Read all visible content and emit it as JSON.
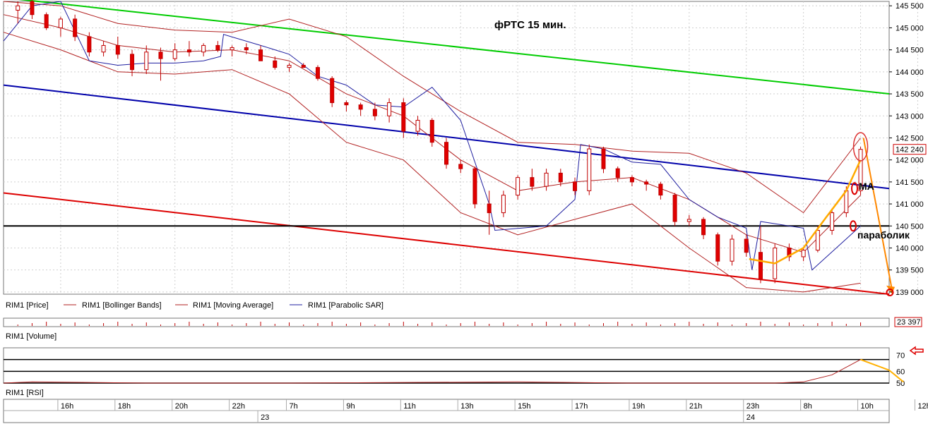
{
  "chart_data": {
    "type": "candlestick",
    "title": "фРТС   15 мин.",
    "price_axis": {
      "ylim": [
        138950,
        145600
      ],
      "ticks": [
        "145 500",
        "145 000",
        "144 500",
        "144 000",
        "143 500",
        "143 000",
        "142 500",
        "142 000",
        "141 500",
        "141 000",
        "140 500",
        "140 000",
        "139 500",
        "139 000"
      ],
      "last_price_label": "142 240",
      "last_price": 142240
    },
    "time_axis": {
      "labels": [
        "16h",
        "18h",
        "20h",
        "22h",
        "7h",
        "9h",
        "11h",
        "13h",
        "15h",
        "17h",
        "19h",
        "21h",
        "23h",
        "8h",
        "10h",
        "12h"
      ],
      "day_labels": [
        "23",
        "24"
      ],
      "range_hours": [
        0,
        31
      ]
    },
    "candles": [
      {
        "t": 0.5,
        "o": 145400,
        "h": 145600,
        "l": 145100,
        "c": 145500
      },
      {
        "t": 1.0,
        "o": 145600,
        "h": 145650,
        "l": 145200,
        "c": 145300
      },
      {
        "t": 1.5,
        "o": 145300,
        "h": 145350,
        "l": 144950,
        "c": 145000
      },
      {
        "t": 2.0,
        "o": 145000,
        "h": 145250,
        "l": 144800,
        "c": 145200
      },
      {
        "t": 2.5,
        "o": 145200,
        "h": 145300,
        "l": 144700,
        "c": 144800
      },
      {
        "t": 3.0,
        "o": 144800,
        "h": 144900,
        "l": 144350,
        "c": 144450
      },
      {
        "t": 3.5,
        "o": 144450,
        "h": 144700,
        "l": 144350,
        "c": 144600
      },
      {
        "t": 4.0,
        "o": 144600,
        "h": 144800,
        "l": 144300,
        "c": 144400
      },
      {
        "t": 4.5,
        "o": 144400,
        "h": 144500,
        "l": 143900,
        "c": 144050
      },
      {
        "t": 5.0,
        "o": 144050,
        "h": 144600,
        "l": 143950,
        "c": 144450
      },
      {
        "t": 5.5,
        "o": 144450,
        "h": 144550,
        "l": 143800,
        "c": 144300
      },
      {
        "t": 6.0,
        "o": 144300,
        "h": 144650,
        "l": 144250,
        "c": 144500
      },
      {
        "t": 6.5,
        "o": 144500,
        "h": 144700,
        "l": 144350,
        "c": 144450
      },
      {
        "t": 7.0,
        "o": 144450,
        "h": 144650,
        "l": 144350,
        "c": 144600
      },
      {
        "t": 7.5,
        "o": 144600,
        "h": 144700,
        "l": 144450,
        "c": 144500
      },
      {
        "t": 8.0,
        "o": 144500,
        "h": 144600,
        "l": 144350,
        "c": 144550
      },
      {
        "t": 8.5,
        "o": 144550,
        "h": 144650,
        "l": 144400,
        "c": 144500
      },
      {
        "t": 9.0,
        "o": 144500,
        "h": 144600,
        "l": 144350,
        "c": 144250
      },
      {
        "t": 9.5,
        "o": 144250,
        "h": 144350,
        "l": 144050,
        "c": 144100
      },
      {
        "t": 10.0,
        "o": 144100,
        "h": 144200,
        "l": 144000,
        "c": 144150
      },
      {
        "t": 10.5,
        "o": 144150,
        "h": 144200,
        "l": 144100,
        "c": 144100
      },
      {
        "t": 11.0,
        "o": 144100,
        "h": 144150,
        "l": 143800,
        "c": 143850
      },
      {
        "t": 11.5,
        "o": 143850,
        "h": 143900,
        "l": 143200,
        "c": 143300
      },
      {
        "t": 12.0,
        "o": 143300,
        "h": 143350,
        "l": 143100,
        "c": 143250
      },
      {
        "t": 12.5,
        "o": 143250,
        "h": 143300,
        "l": 143000,
        "c": 143150
      },
      {
        "t": 13.0,
        "o": 143150,
        "h": 143300,
        "l": 142900,
        "c": 143000
      },
      {
        "t": 13.5,
        "o": 143000,
        "h": 143400,
        "l": 142850,
        "c": 143300
      },
      {
        "t": 14.0,
        "o": 143300,
        "h": 143400,
        "l": 142500,
        "c": 142650
      },
      {
        "t": 14.5,
        "o": 142650,
        "h": 143000,
        "l": 142550,
        "c": 142900
      },
      {
        "t": 15.0,
        "o": 142900,
        "h": 142950,
        "l": 142300,
        "c": 142400
      },
      {
        "t": 15.5,
        "o": 142400,
        "h": 142500,
        "l": 141800,
        "c": 141900
      },
      {
        "t": 16.0,
        "o": 141900,
        "h": 142000,
        "l": 141700,
        "c": 141800
      },
      {
        "t": 16.5,
        "o": 141800,
        "h": 141850,
        "l": 140900,
        "c": 141000
      },
      {
        "t": 17.0,
        "o": 141000,
        "h": 141300,
        "l": 140300,
        "c": 140800
      },
      {
        "t": 17.5,
        "o": 140800,
        "h": 141300,
        "l": 140700,
        "c": 141200
      },
      {
        "t": 18.0,
        "o": 141200,
        "h": 141650,
        "l": 141100,
        "c": 141600
      },
      {
        "t": 18.5,
        "o": 141600,
        "h": 141800,
        "l": 141300,
        "c": 141400
      },
      {
        "t": 19.0,
        "o": 141400,
        "h": 141800,
        "l": 141300,
        "c": 141700
      },
      {
        "t": 19.5,
        "o": 141700,
        "h": 141800,
        "l": 141400,
        "c": 141500
      },
      {
        "t": 20.0,
        "o": 141500,
        "h": 141600,
        "l": 141200,
        "c": 141300
      },
      {
        "t": 20.5,
        "o": 141300,
        "h": 142350,
        "l": 141200,
        "c": 142250
      },
      {
        "t": 21.0,
        "o": 142250,
        "h": 142300,
        "l": 141700,
        "c": 141800
      },
      {
        "t": 21.5,
        "o": 141800,
        "h": 141850,
        "l": 141500,
        "c": 141600
      },
      {
        "t": 22.0,
        "o": 141600,
        "h": 141650,
        "l": 141400,
        "c": 141500
      },
      {
        "t": 22.5,
        "o": 141500,
        "h": 141550,
        "l": 141300,
        "c": 141450
      },
      {
        "t": 23.0,
        "o": 141450,
        "h": 141500,
        "l": 141100,
        "c": 141200
      },
      {
        "t": 23.5,
        "o": 141200,
        "h": 141250,
        "l": 140500,
        "c": 140600
      },
      {
        "t": 24.0,
        "o": 140600,
        "h": 140750,
        "l": 140500,
        "c": 140650
      },
      {
        "t": 24.5,
        "o": 140650,
        "h": 140700,
        "l": 140200,
        "c": 140300
      },
      {
        "t": 25.0,
        "o": 140300,
        "h": 140350,
        "l": 139600,
        "c": 139700
      },
      {
        "t": 25.5,
        "o": 139700,
        "h": 140300,
        "l": 139600,
        "c": 140200
      },
      {
        "t": 26.0,
        "o": 140200,
        "h": 140300,
        "l": 139800,
        "c": 139900
      },
      {
        "t": 26.5,
        "o": 139900,
        "h": 140500,
        "l": 139200,
        "c": 139300
      },
      {
        "t": 27.0,
        "o": 139300,
        "h": 140100,
        "l": 139200,
        "c": 140000
      },
      {
        "t": 27.5,
        "o": 140000,
        "h": 140100,
        "l": 139700,
        "c": 139800
      },
      {
        "t": 28.0,
        "o": 139800,
        "h": 140000,
        "l": 139700,
        "c": 139950
      },
      {
        "t": 28.5,
        "o": 139950,
        "h": 140500,
        "l": 139900,
        "c": 140400
      },
      {
        "t": 29.0,
        "o": 140400,
        "h": 140900,
        "l": 140300,
        "c": 140800
      },
      {
        "t": 29.5,
        "o": 140800,
        "h": 141400,
        "l": 140700,
        "c": 141300
      },
      {
        "t": 30.0,
        "o": 141300,
        "h": 142300,
        "l": 141200,
        "c": 142240
      }
    ],
    "series": [
      {
        "name": "RIM1 [Price]",
        "color": "#000000"
      },
      {
        "name": "RIM1 [Bollinger Bands]",
        "color": "#b22222"
      },
      {
        "name": "RIM1 [Moving Average]",
        "color": "#b22222"
      },
      {
        "name": "RIM1 [Parabolic SAR]",
        "color": "#1f1fa0"
      }
    ],
    "moving_average": [
      [
        0,
        145300
      ],
      [
        2,
        145000
      ],
      [
        4,
        144600
      ],
      [
        6,
        144450
      ],
      [
        8,
        144500
      ],
      [
        10,
        144250
      ],
      [
        12,
        143500
      ],
      [
        14,
        143000
      ],
      [
        16,
        142000
      ],
      [
        18,
        141300
      ],
      [
        20,
        141500
      ],
      [
        22,
        141600
      ],
      [
        24,
        141100
      ],
      [
        26,
        140300
      ],
      [
        28,
        139900
      ],
      [
        30,
        141200
      ]
    ],
    "bollinger_upper": [
      [
        0,
        145600
      ],
      [
        2,
        145500
      ],
      [
        4,
        145100
      ],
      [
        6,
        144950
      ],
      [
        8,
        144900
      ],
      [
        10,
        145200
      ],
      [
        12,
        144800
      ],
      [
        14,
        143900
      ],
      [
        16,
        143100
      ],
      [
        18,
        142400
      ],
      [
        20,
        142350
      ],
      [
        22,
        142200
      ],
      [
        24,
        142150
      ],
      [
        26,
        141700
      ],
      [
        28,
        140800
      ],
      [
        30,
        142500
      ]
    ],
    "bollinger_lower": [
      [
        0,
        144900
      ],
      [
        2,
        144500
      ],
      [
        4,
        144000
      ],
      [
        6,
        143950
      ],
      [
        8,
        144050
      ],
      [
        10,
        143500
      ],
      [
        12,
        142400
      ],
      [
        14,
        142000
      ],
      [
        16,
        140800
      ],
      [
        18,
        140300
      ],
      [
        20,
        140650
      ],
      [
        22,
        141000
      ],
      [
        24,
        140000
      ],
      [
        26,
        139100
      ],
      [
        28,
        139000
      ],
      [
        30,
        139200
      ]
    ],
    "parabolic_sar": [
      [
        0,
        144700
      ],
      [
        1,
        145500
      ],
      [
        2,
        145600
      ],
      [
        3,
        144250
      ],
      [
        4,
        144150
      ],
      [
        5,
        144200
      ],
      [
        6,
        144200
      ],
      [
        7,
        144250
      ],
      [
        7.6,
        144350
      ],
      [
        7.7,
        144850
      ],
      [
        9,
        144600
      ],
      [
        10,
        144400
      ],
      [
        11,
        143900
      ],
      [
        12,
        143700
      ],
      [
        13,
        143250
      ],
      [
        14,
        143200
      ],
      [
        15,
        143650
      ],
      [
        16,
        142900
      ],
      [
        17,
        141000
      ],
      [
        17.2,
        140400
      ],
      [
        19,
        140500
      ],
      [
        20,
        141100
      ],
      [
        20.2,
        142350
      ],
      [
        21,
        142250
      ],
      [
        22,
        141950
      ],
      [
        23,
        141900
      ],
      [
        24,
        141100
      ],
      [
        25,
        140700
      ],
      [
        26,
        140450
      ],
      [
        26.2,
        139500
      ],
      [
        26.5,
        140600
      ],
      [
        28,
        140450
      ],
      [
        28.3,
        139500
      ],
      [
        30,
        140500
      ]
    ],
    "trend_lines": [
      {
        "color": "#00cc00",
        "from": [
          0.5,
          145650
        ],
        "to": [
          31,
          143500
        ]
      },
      {
        "color": "#0000aa",
        "from": [
          0,
          143700
        ],
        "to": [
          31,
          141350
        ]
      },
      {
        "color": "#dd0000",
        "from": [
          0,
          141250
        ],
        "to": [
          31,
          138950
        ]
      },
      {
        "color": "#000000",
        "from": [
          0,
          140500
        ],
        "to": [
          31,
          140500
        ]
      }
    ],
    "projection": {
      "color": "#ff8800",
      "points": [
        [
          30.1,
          142500
        ],
        [
          31.1,
          139050
        ]
      ]
    },
    "forecast_curve": {
      "color": "#ffaa00",
      "points": [
        [
          26.1,
          139750
        ],
        [
          27,
          139650
        ],
        [
          28,
          140000
        ],
        [
          28.8,
          140700
        ],
        [
          29.5,
          141300
        ],
        [
          30,
          142000
        ]
      ]
    },
    "annotations": [
      {
        "text": "МА",
        "price": 141350
      },
      {
        "text": "параболик",
        "price": 140350
      }
    ],
    "volume_panel": {
      "label": "RIM1 [Volume]",
      "last_label": "23 397",
      "max": 23397
    },
    "rsi_panel": {
      "label": "RIM1 [RSI]",
      "levels": [
        70,
        60,
        50
      ],
      "ticks": [
        "70",
        "60",
        "50"
      ]
    },
    "rsi": [
      [
        0,
        50
      ],
      [
        1,
        51
      ],
      [
        5,
        50
      ],
      [
        10,
        50
      ],
      [
        18,
        51
      ],
      [
        22,
        50
      ],
      [
        27,
        50
      ],
      [
        28,
        51
      ],
      [
        29,
        57
      ],
      [
        30,
        70
      ],
      [
        31,
        61
      ],
      [
        31.5,
        51
      ]
    ]
  }
}
